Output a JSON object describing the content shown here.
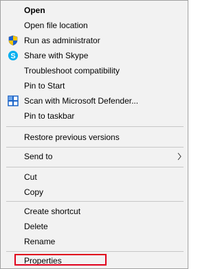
{
  "menu": {
    "items": [
      {
        "id": "open",
        "label": "Open"
      },
      {
        "id": "open-file-location",
        "label": "Open file location"
      },
      {
        "id": "run-as-admin",
        "label": "Run as administrator",
        "icon": "uac-shield-icon"
      },
      {
        "id": "share-skype",
        "label": "Share with Skype",
        "icon": "skype-icon"
      },
      {
        "id": "troubleshoot",
        "label": "Troubleshoot compatibility"
      },
      {
        "id": "pin-start",
        "label": "Pin to Start"
      },
      {
        "id": "scan-defender",
        "label": "Scan with Microsoft Defender...",
        "icon": "defender-icon"
      },
      {
        "id": "pin-taskbar",
        "label": "Pin to taskbar"
      },
      {
        "id": "restore-versions",
        "label": "Restore previous versions"
      },
      {
        "id": "send-to",
        "label": "Send to",
        "icon": "chevron-right-icon"
      },
      {
        "id": "cut",
        "label": "Cut"
      },
      {
        "id": "copy",
        "label": "Copy"
      },
      {
        "id": "create-shortcut",
        "label": "Create shortcut"
      },
      {
        "id": "delete",
        "label": "Delete"
      },
      {
        "id": "rename",
        "label": "Rename"
      },
      {
        "id": "properties",
        "label": "Properties"
      }
    ]
  },
  "colors": {
    "menu_background": "#f2f2f2",
    "highlight_border": "#e0001b",
    "separator": "#c7c7c7"
  }
}
